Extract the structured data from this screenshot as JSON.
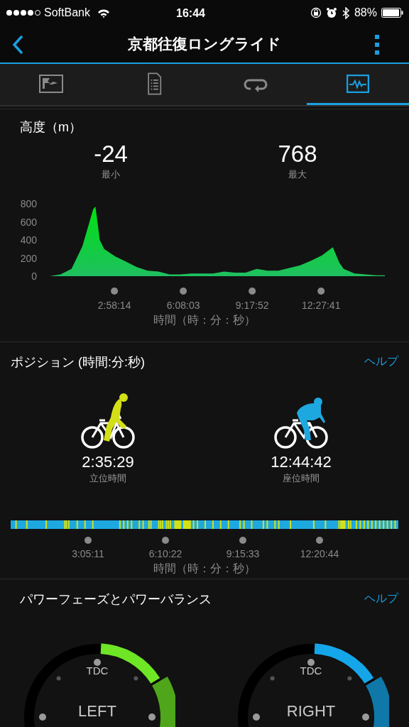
{
  "status_bar": {
    "carrier": "SoftBank",
    "time": "16:44",
    "battery": "88%"
  },
  "nav": {
    "title": "京都往復ロングライド"
  },
  "tabs": [
    {
      "selected": false
    },
    {
      "selected": false
    },
    {
      "selected": false
    },
    {
      "selected": true
    }
  ],
  "elevation": {
    "title": "高度（m）",
    "stats": [
      {
        "value": "-24",
        "label": "最小"
      },
      {
        "value": "768",
        "label": "最大"
      }
    ],
    "y_labels": [
      "800",
      "600",
      "400",
      "200",
      "0"
    ],
    "x_labels": [
      "2:58:14",
      "6:08:03",
      "9:17:52",
      "12:27:41"
    ],
    "axis_label": "時間（時：分：秒）"
  },
  "position": {
    "title": "ポジション (時間:分:秒)",
    "help": "ヘルプ",
    "riders": [
      {
        "kind": "standing",
        "color": "#d4e017",
        "time": "2:35:29",
        "label": "立位時間"
      },
      {
        "kind": "seated",
        "color": "#1ea8e0",
        "time": "12:44:42",
        "label": "座位時間"
      }
    ],
    "ticks": [
      "3:05:11",
      "6:10:22",
      "9:15:33",
      "12:20:44"
    ],
    "axis_label": "時間（時：分：秒）"
  },
  "power": {
    "title": "パワーフェーズとパワーバランス",
    "help": "ヘルプ",
    "dials": [
      {
        "top": "TDC",
        "side": "LEFT",
        "color": "#6ee626"
      },
      {
        "top": "TDC",
        "side": "RIGHT",
        "color": "#15a6ea"
      }
    ]
  }
}
